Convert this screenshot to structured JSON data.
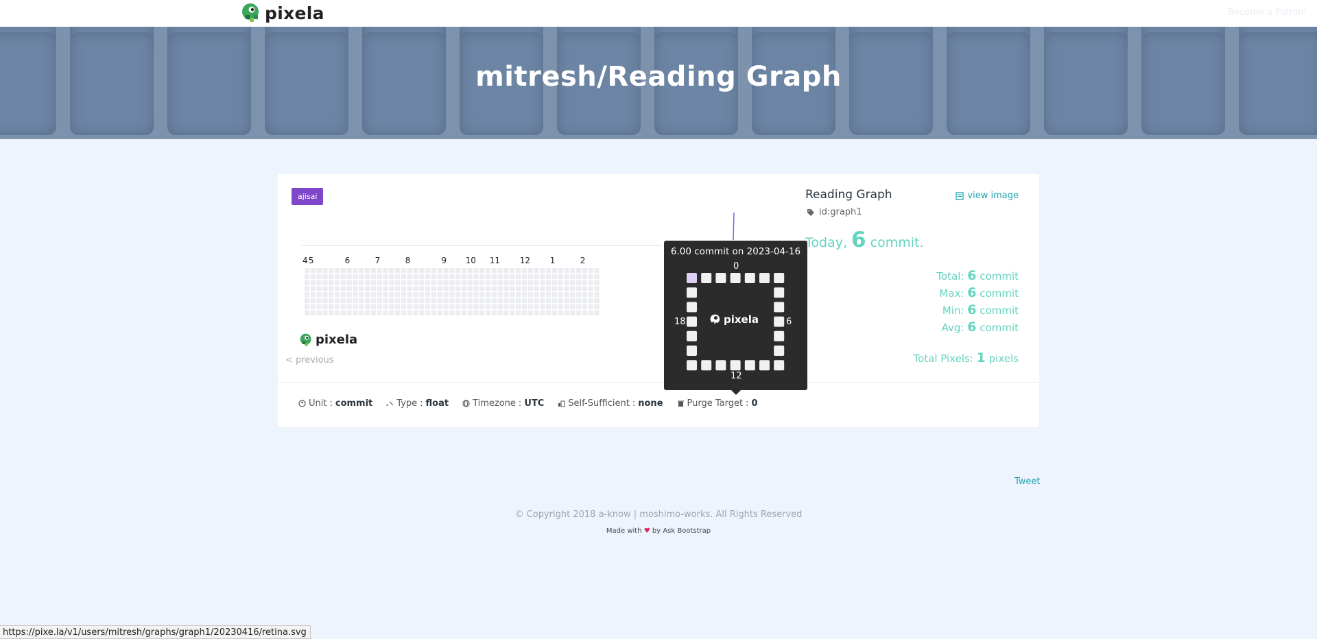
{
  "nav": {
    "brand": "pixela",
    "patron_link": "Become a Patron!"
  },
  "hero": {
    "title": "mitresh/Reading Graph"
  },
  "card": {
    "theme_badge": "ajisai",
    "month_labels": [
      "4",
      "5",
      "6",
      "7",
      "8",
      "9",
      "10",
      "11",
      "12",
      "1",
      "2"
    ],
    "graph_logo": "pixela",
    "previous_link": "< previous",
    "graph_name": "Reading Graph",
    "graph_id": "id:graph1",
    "view_image": "view image",
    "today": {
      "prefix": "Today",
      "comma": ",",
      "value": "6",
      "unit": "commit."
    },
    "stats": [
      {
        "label": "Total:",
        "value": "6",
        "unit": "commit"
      },
      {
        "label": "Max:",
        "value": "6",
        "unit": "commit"
      },
      {
        "label": "Min:",
        "value": "6",
        "unit": "commit"
      },
      {
        "label": "Avg:",
        "value": "6",
        "unit": "commit"
      }
    ],
    "total_pixels": {
      "label": "Total Pixels:",
      "value": "1",
      "unit": "pixels"
    },
    "meta": [
      {
        "icon": "unit-icon",
        "label": "Unit",
        "sep": ":",
        "value": "commit"
      },
      {
        "icon": "type-icon",
        "label": "Type",
        "sep": ":",
        "value": "float"
      },
      {
        "icon": "globe-icon",
        "label": "Timezone",
        "sep": ":",
        "value": "UTC"
      },
      {
        "icon": "self-sufficient-icon",
        "label": "Self-Sufficient",
        "sep": ":",
        "value": "none"
      },
      {
        "icon": "trash-icon",
        "label": "Purge Target",
        "sep": ":",
        "value": "0"
      }
    ]
  },
  "tooltip": {
    "title": "6.00 commit on 2023-04-16",
    "label_top": "0",
    "label_right": "6",
    "label_bottom": "12",
    "label_left": "18",
    "logo": "pixela",
    "active_hour": 21,
    "active_color": "#e0d0f5"
  },
  "footer": {
    "tweet": "Tweet",
    "copyright": "© Copyright 2018 a-know | moshimo-works. All Rights Reserved",
    "made_with_prefix": "Made with",
    "made_with_heart": "♥",
    "made_with_suffix": "by Ask Bootstrap"
  },
  "status_bar": {
    "url": "https://pixe.la/v1/users/mitresh/graphs/graph1/20230416/retina.svg"
  },
  "colors": {
    "accent_teal": "#63d4c0",
    "link": "#1fa4b0",
    "badge_purple": "#7e46c8",
    "empty_pixel": "#ebedf0"
  }
}
